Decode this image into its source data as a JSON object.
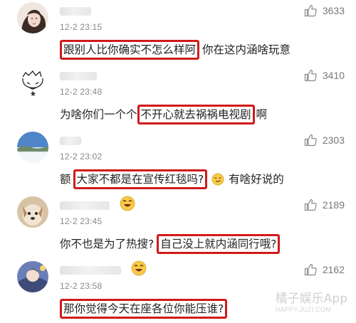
{
  "comments": [
    {
      "time": "12-2 23:15",
      "likes": "3633",
      "text": {
        "pre": "",
        "highlight": "跟别人比你确实不怎么样阿",
        "post": "你在这内涵啥玩意"
      },
      "avatar_icon": "woman-photo-avatar-icon"
    },
    {
      "time": "12-2 23:48",
      "likes": "3410",
      "text": {
        "pre": "为啥你们一个个",
        "highlight": "不开心就去祸祸电视剧",
        "post": "啊"
      },
      "avatar_icon": "doodle-face-avatar-icon"
    },
    {
      "time": "12-2 23:02",
      "likes": "2303",
      "text": {
        "pre": "额",
        "highlight": "大家不都是在宣传红毯吗?",
        "post": "有啥好说的"
      },
      "avatar_icon": "landscape-avatar-icon"
    },
    {
      "time": "12-2 23:45",
      "likes": "2189",
      "text": {
        "pre": "你不也是为了热搜?",
        "highlight": "自己没上就内涵同行哦?",
        "post": ""
      },
      "avatar_icon": "dog-avatar-icon"
    },
    {
      "time": "12-2 23:58",
      "likes": "2162",
      "text": {
        "pre": "",
        "highlight": "那你觉得今天在座各位你能压谁?",
        "post": ""
      },
      "avatar_icon": "anime-avatar-icon"
    }
  ],
  "watermark": {
    "main": "橘子娱乐App",
    "sub": "HAPPY.JUZI.COM"
  },
  "colors": {
    "highlight": "#d01a1a",
    "like_icon": "#8a8a8a"
  }
}
